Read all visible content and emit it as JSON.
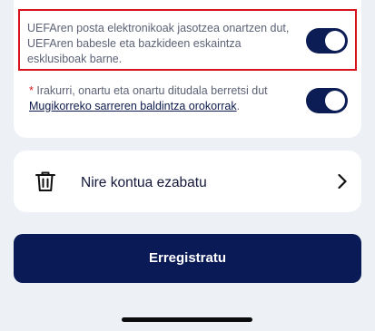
{
  "consents": [
    {
      "text": "UEFAren posta elektronikoak jasotzea onartzen dut, UEFAren babesle eta bazkideen eskaintza esklusiboak barne.",
      "enabled": true
    },
    {
      "required_marker": "*",
      "text": " Irakurri, onartu eta onartu ditudala berretsi dut ",
      "link_text": "Mugikorreko sarreren baldintza orokorrak",
      "suffix": ".",
      "enabled": true
    }
  ],
  "delete_account": {
    "label": "Nire kontua ezabatu",
    "icon": "trash-icon",
    "chevron": "chevron-right-icon"
  },
  "register_button": {
    "label": "Erregistratu"
  },
  "colors": {
    "primary": "#0a1a56",
    "highlight": "#d7141c",
    "background": "#edf0f5"
  }
}
